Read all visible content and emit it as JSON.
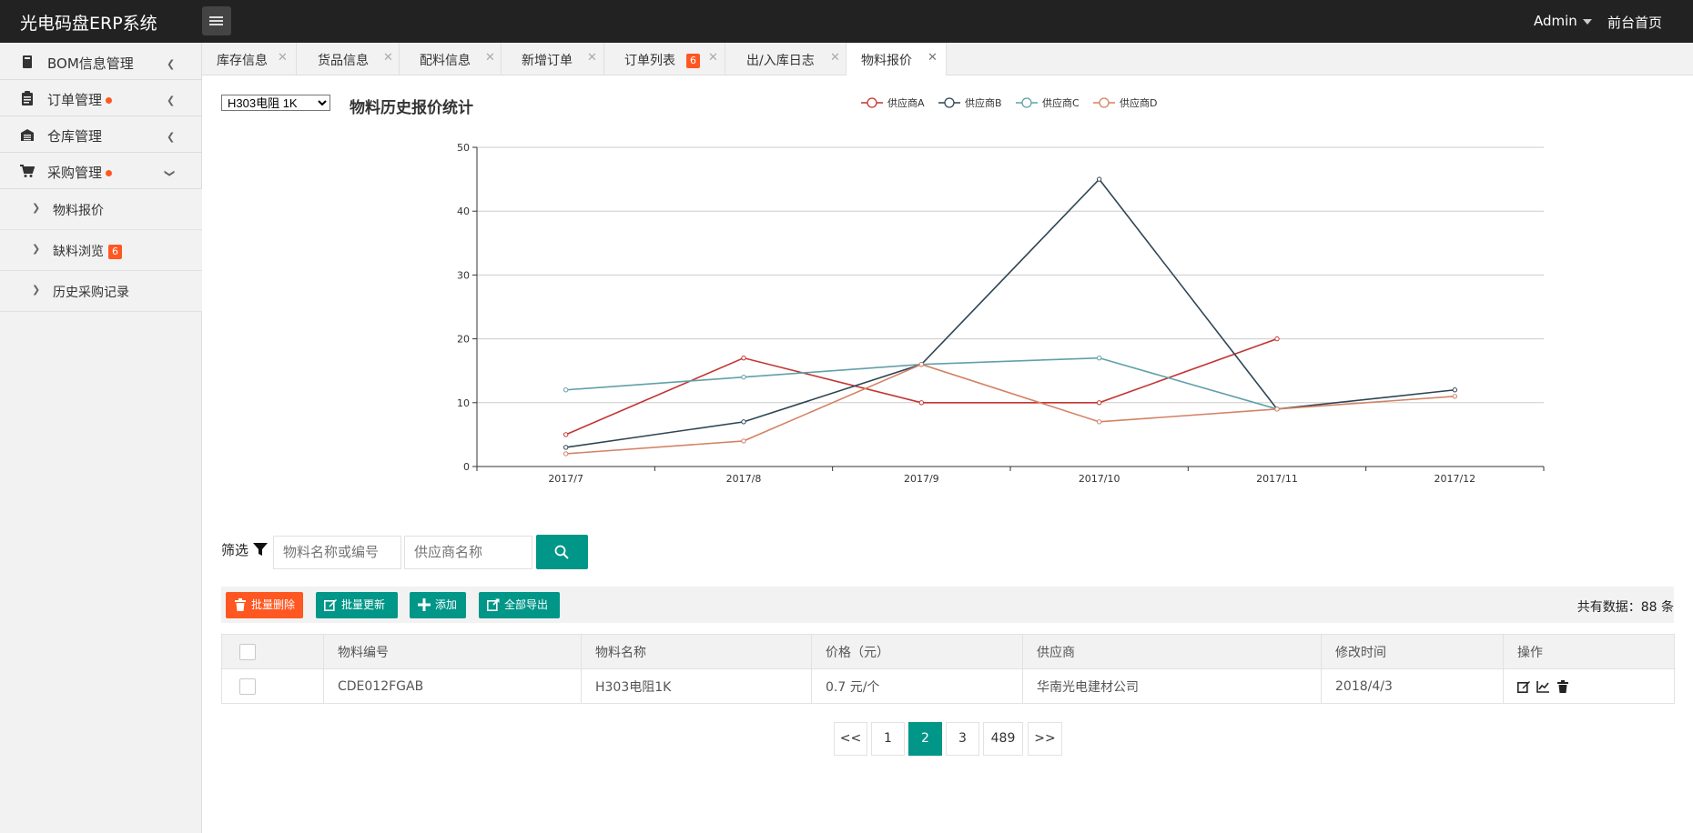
{
  "header": {
    "app_title": "光电码盘ERP系统",
    "user": "Admin",
    "home_link": "前台首页"
  },
  "sidebar": {
    "items": [
      {
        "label": "BOM信息管理",
        "icon": "book-icon"
      },
      {
        "label": "订单管理",
        "icon": "clipboard-icon",
        "dot": true
      },
      {
        "label": "仓库管理",
        "icon": "warehouse-icon"
      },
      {
        "label": "采购管理",
        "icon": "cart-icon",
        "dot": true,
        "expanded": true
      }
    ],
    "sub_items": [
      {
        "label": "物料报价"
      },
      {
        "label": "缺料浏览",
        "badge": "6"
      },
      {
        "label": "历史采购记录"
      }
    ]
  },
  "tabs": [
    {
      "label": "库存信息"
    },
    {
      "label": "货品信息"
    },
    {
      "label": "配料信息"
    },
    {
      "label": "新增订单"
    },
    {
      "label": "订单列表",
      "badge": "6"
    },
    {
      "label": "出/入库日志"
    },
    {
      "label": "物料报价",
      "active": true
    }
  ],
  "material_select": {
    "value": "H303电阻 1K"
  },
  "chart_data": {
    "type": "line",
    "title": "物料历史报价统计",
    "categories": [
      "2017/7",
      "2017/8",
      "2017/9",
      "2017/10",
      "2017/11",
      "2017/12"
    ],
    "ylim": [
      0,
      50
    ],
    "yticks": [
      "0",
      "10",
      "20",
      "30",
      "40",
      "50"
    ],
    "grid": true,
    "legend_position": "top",
    "series": [
      {
        "name": "供应商A",
        "color": "#c23531",
        "values": [
          5,
          17,
          10,
          10,
          20,
          null
        ]
      },
      {
        "name": "供应商B",
        "color": "#2f4554",
        "values": [
          3,
          7,
          16,
          45,
          9,
          12
        ]
      },
      {
        "name": "供应商C",
        "color": "#61a0a8",
        "values": [
          12,
          14,
          16,
          17,
          9,
          null
        ]
      },
      {
        "name": "供应商D",
        "color": "#d48265",
        "values": [
          2,
          4,
          16,
          7,
          9,
          11
        ]
      }
    ]
  },
  "filter": {
    "label": "筛选",
    "material_placeholder": "物料名称或编号",
    "supplier_placeholder": "供应商名称"
  },
  "toolbar": {
    "batch_delete": "批量删除",
    "batch_update": "批量更新",
    "add": "添加",
    "export_all": "全部导出",
    "total_text": "共有数据：88 条"
  },
  "table": {
    "headers": [
      "物料编号",
      "物料名称",
      "价格（元）",
      "供应商",
      "修改时间",
      "操作"
    ],
    "rows": [
      {
        "code": "CDE012FGAB",
        "name": "H303电阻1K",
        "price": "0.7 元/个",
        "supplier": "华南光电建材公司",
        "modified": "2018/4/3"
      }
    ]
  },
  "pagination": {
    "prev": "<<",
    "pages": [
      "1",
      "2",
      "3",
      "489"
    ],
    "current": "2",
    "next": ">>"
  }
}
